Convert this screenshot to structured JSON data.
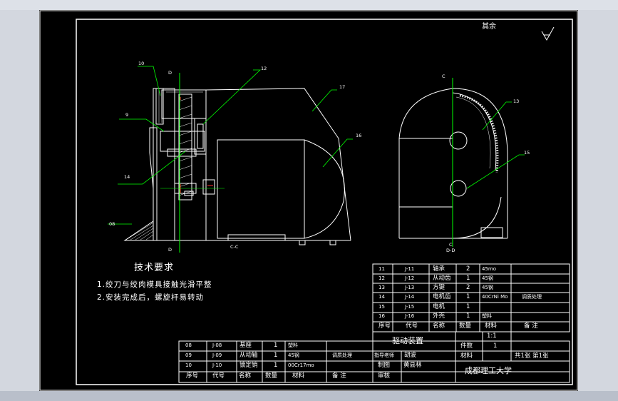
{
  "colors": {
    "background": "#000000",
    "lines": "#ffffff",
    "leaders": "#00ff00",
    "accent_red": "#ff3030",
    "outer": "#d3d7df"
  },
  "surface_note": "其余",
  "technical": {
    "title": "技术要求",
    "note1": "1.绞刀与绞肉模具接触光滑平整",
    "note2": "2.安装完成后，螺旋杆易转动"
  },
  "views": {
    "left": {
      "section_label": "C-C",
      "cut_top": "D",
      "cut_bottom": "D"
    },
    "right": {
      "cut_top": "C",
      "cut_bottom": "C",
      "section_label": "D-D"
    }
  },
  "balloons": {
    "b10": "10",
    "b12": "12",
    "b17": "17",
    "b9": "9",
    "b16": "16",
    "b14": "14",
    "b08": "08",
    "b13": "13",
    "b15": "15"
  },
  "bom_upper": {
    "rows": [
      {
        "no": "11",
        "code": "J-11",
        "name": "轴承",
        "qty": "2",
        "material": "45mo",
        "remark": ""
      },
      {
        "no": "12",
        "code": "J-12",
        "name": "从动齿",
        "qty": "1",
        "material": "45钢",
        "remark": ""
      },
      {
        "no": "13",
        "code": "J-13",
        "name": "方键",
        "qty": "2",
        "material": "45钢",
        "remark": ""
      },
      {
        "no": "14",
        "code": "J-14",
        "name": "电机齿",
        "qty": "1",
        "material": "40CrNi Mo",
        "remark": "调质处理"
      },
      {
        "no": "15",
        "code": "J-15",
        "name": "电机",
        "qty": "1",
        "material": "",
        "remark": ""
      },
      {
        "no": "16",
        "code": "J-16",
        "name": "外壳",
        "qty": "1",
        "material": "塑料",
        "remark": ""
      }
    ],
    "header": {
      "no": "序号",
      "code": "代号",
      "name": "名称",
      "qty": "数量",
      "material": "材料",
      "remark": "备   注"
    }
  },
  "bom_lower": {
    "rows": [
      {
        "no": "08",
        "code": "J-08",
        "name": "基座",
        "qty": "1",
        "material": "塑料",
        "remark": ""
      },
      {
        "no": "09",
        "code": "J-09",
        "name": "从动轴",
        "qty": "1",
        "material": "45钢",
        "remark": "调质处理"
      },
      {
        "no": "10",
        "code": "J-10",
        "name": "锁定销",
        "qty": "1",
        "material": "00Cr17mo",
        "remark": ""
      }
    ],
    "header": {
      "no": "序号",
      "code": "代号",
      "name": "名称",
      "qty": "数量",
      "material": "材料",
      "remark": "备   注"
    }
  },
  "title_block": {
    "drawing_name": "驱动装置",
    "scale": "1:1",
    "count_label": "件数",
    "count": "1",
    "material_label": "材料",
    "sheets": "共1张  第1张",
    "school": "成都理工大学",
    "instructor_label": "指导老师",
    "instructor": "胡波",
    "drafter_label": "制图",
    "drafter": "黄县林",
    "reviewer_label": "审核"
  }
}
